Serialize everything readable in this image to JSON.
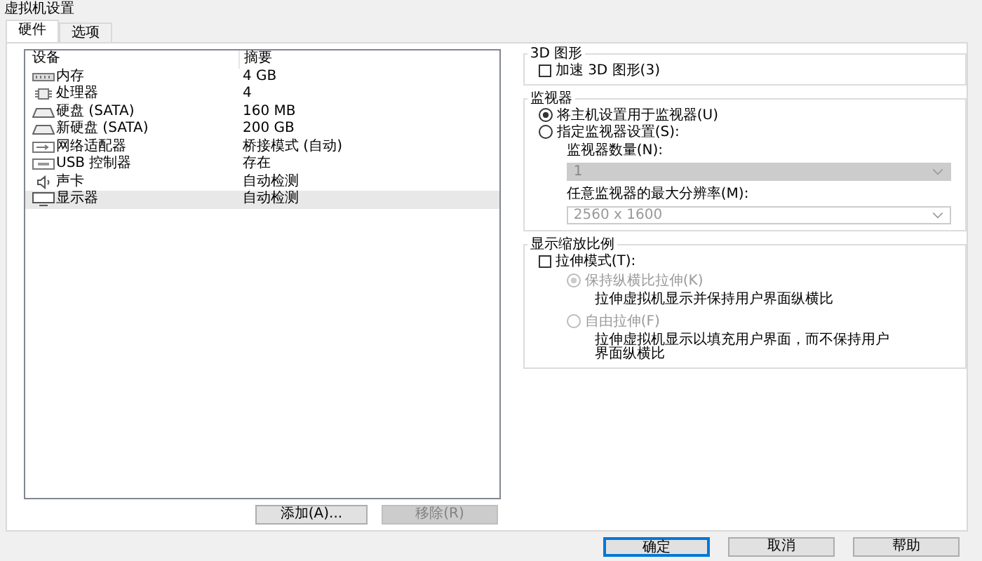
{
  "window": {
    "title": "虚拟机设置"
  },
  "tabs": [
    {
      "label": "硬件",
      "selected": true
    },
    {
      "label": "选项",
      "selected": false
    }
  ],
  "devices": {
    "columns": [
      "设备",
      "摘要"
    ],
    "rows": [
      {
        "kind": "memory",
        "name": "内存",
        "summary": "4 GB",
        "selected": false
      },
      {
        "kind": "cpu",
        "name": "处理器",
        "summary": "4",
        "selected": false
      },
      {
        "kind": "disk",
        "name": "硬盘 (SATA)",
        "summary": "160 MB",
        "selected": false
      },
      {
        "kind": "disk",
        "name": "新硬盘 (SATA)",
        "summary": "200 GB",
        "selected": false
      },
      {
        "kind": "network",
        "name": "网络适配器",
        "summary": "桥接模式 (自动)",
        "selected": false
      },
      {
        "kind": "usb",
        "name": "USB 控制器",
        "summary": "存在",
        "selected": false
      },
      {
        "kind": "sound",
        "name": "声卡",
        "summary": "自动检测",
        "selected": false
      },
      {
        "kind": "display",
        "name": "显示器",
        "summary": "自动检测",
        "selected": true
      }
    ],
    "buttons": [
      {
        "label": "添加(A)...",
        "disabled": false
      },
      {
        "label": "移除(R)",
        "disabled": true
      }
    ]
  },
  "graphics": {
    "title": "3D 图形",
    "accelerate": {
      "label": "加速 3D 图形(3)",
      "checked": false
    }
  },
  "monitors": {
    "title": "监视器",
    "options": [
      {
        "label": "将主机设置用于监视器(U)",
        "selected": true
      },
      {
        "label": "指定监视器设置(S):",
        "selected": false
      }
    ],
    "count": {
      "label": "监视器数量(N):",
      "value": "1",
      "disabled": true
    },
    "resolution": {
      "label": "任意监视器的最大分辨率(M):",
      "value": "2560 x 1600",
      "disabled": true
    }
  },
  "scaling": {
    "title": "显示缩放比例",
    "stretch": {
      "label": "拉伸模式(T):",
      "checked": false
    },
    "options": [
      {
        "label": "保持纵横比拉伸(K)",
        "description": "拉伸虚拟机显示并保持用户界面纵横比",
        "selected": true,
        "disabled": true
      },
      {
        "label": "自由拉伸(F)",
        "description": "拉伸虚拟机显示以填充用户界面，而不保持用户界面纵横比",
        "selected": false,
        "disabled": true
      }
    ]
  },
  "footer": [
    {
      "label": "确定",
      "default": true
    },
    {
      "label": "取消",
      "default": false
    },
    {
      "label": "帮助",
      "default": false
    }
  ]
}
